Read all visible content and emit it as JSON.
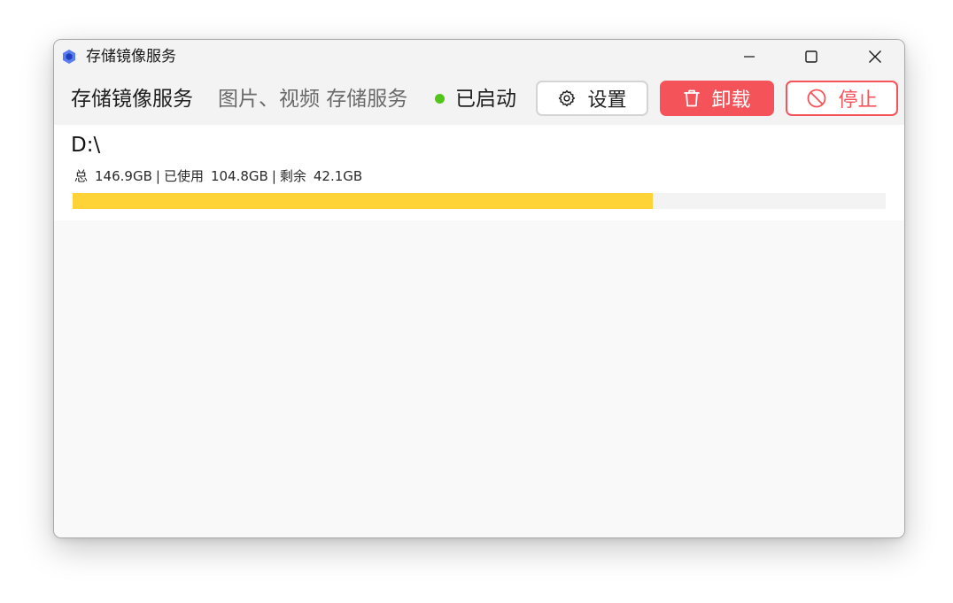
{
  "window": {
    "title": "存储镜像服务",
    "icon": "hexagon-app-icon",
    "controls": [
      "minimize-icon",
      "maximize-icon",
      "close-icon"
    ]
  },
  "service": {
    "name": "存储镜像服务",
    "description": "图片、视频 存储服务",
    "status": "已启动",
    "status_color": "#52c41a"
  },
  "buttons": {
    "settings": {
      "label": "设置",
      "icon": "gear-icon"
    },
    "uninstall": {
      "label": "卸载",
      "icon": "trash-icon",
      "color": "#f5535a"
    },
    "stop": {
      "label": "停止",
      "icon": "prohibit-icon",
      "color": "#f5535a"
    }
  },
  "drive": {
    "name": "D:\\",
    "total_label": "总",
    "total": "146.9GB",
    "used_label": "已使用",
    "used": "104.8GB",
    "free_label": "剩余",
    "free": "42.1GB",
    "separator": "|",
    "used_fraction": 0.7134,
    "bar_color": "#fed337"
  }
}
